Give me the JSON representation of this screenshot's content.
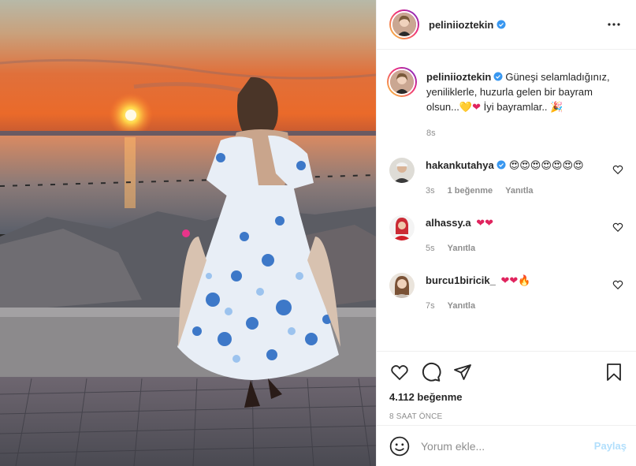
{
  "post": {
    "username": "peliniioztekin",
    "verified": true
  },
  "caption": {
    "username": "peliniioztekin",
    "text": "Güneşi selamladığınız, yeniliklerle, huzurla gelen bir bayram olsun...",
    "emoji_1": "💛",
    "emoji_2": "❤",
    "text_2": " İyi bayramlar..",
    "emoji_3": "🎉",
    "time": "8s"
  },
  "comments": [
    {
      "username": "hakankutahya",
      "verified": true,
      "text": "😍😍😍😍😍😍😍",
      "time": "3s",
      "likes": "1 beğenme",
      "reply": "Yanıtla"
    },
    {
      "username": "alhassy.a",
      "verified": false,
      "text": "❤❤",
      "time": "5s",
      "reply": "Yanıtla"
    },
    {
      "username": "burcu1biricik_",
      "verified": false,
      "text": "❤❤🔥",
      "time": "7s",
      "reply": "Yanıtla"
    }
  ],
  "actions": {
    "like_count": "4.112 beğenme",
    "posted_ago": "8 SAAT ÖNCE"
  },
  "add_comment": {
    "placeholder": "Yorum ekle...",
    "post_label": "Paylaş"
  },
  "colors": {
    "accent_blue": "#0095f6",
    "post_disabled": "#b2dffc",
    "text": "#262626",
    "muted": "#8e8e8e",
    "heart_red": "#ed4956"
  },
  "icons": [
    "more-options-icon",
    "verified-badge-icon",
    "heart-icon",
    "comment-icon",
    "share-icon",
    "bookmark-icon",
    "emoji-icon"
  ]
}
